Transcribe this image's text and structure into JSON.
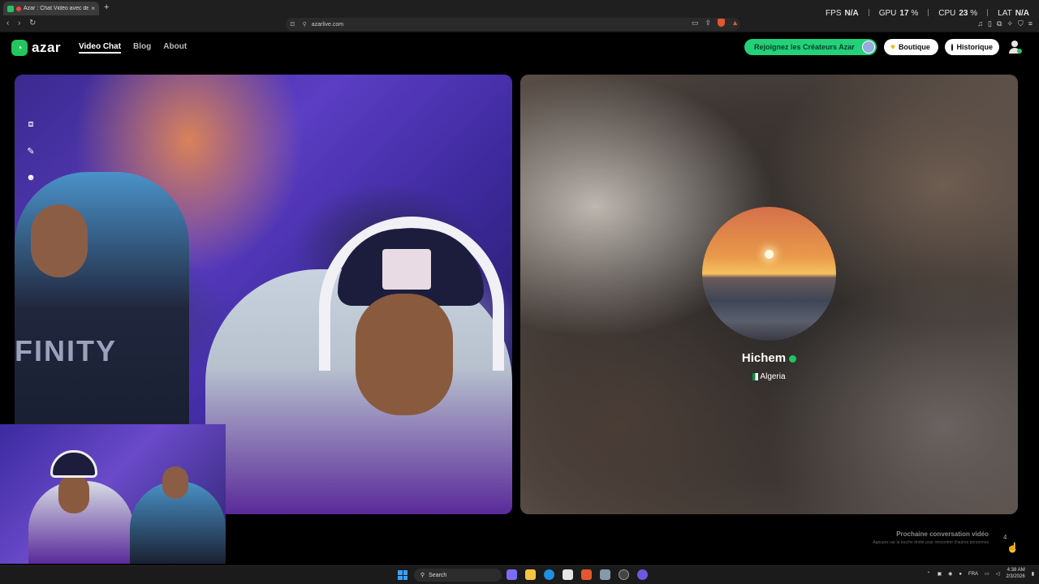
{
  "browser": {
    "tab_title": "Azar : Chat Vidéo avec de no",
    "tab_close": "×",
    "new_tab": "+",
    "url": "azarlive.com",
    "nav": {
      "back": "‹",
      "forward": "›",
      "reload": "↻"
    },
    "bookmark_icon": "bookmark-icon",
    "shield_badge": "1"
  },
  "perf": {
    "fps_label": "FPS",
    "fps_value": "N/A",
    "gpu_label": "GPU",
    "gpu_value": "17",
    "cpu_label": "CPU",
    "cpu_value": "23",
    "lat_label": "LAT",
    "lat_value": "N/A",
    "unit": "%"
  },
  "site": {
    "brand": "azar",
    "nav": [
      {
        "label": "Video Chat",
        "active": true
      },
      {
        "label": "Blog",
        "active": false
      },
      {
        "label": "About",
        "active": false
      }
    ],
    "creators_label": "Rejoignez les Créateurs Azar",
    "boutique_label": "Boutique",
    "historique_label": "Historique",
    "accent": "#22c55e"
  },
  "remote": {
    "name": "Hichem",
    "country": "Algeria"
  },
  "next": {
    "title": "Prochaine conversation vidéo",
    "subtitle": "Appuyez sur la touche droite pour rencontrer d'autres personnes",
    "count": "4"
  },
  "local_overlay_text": "FINITY",
  "taskbar": {
    "search_placeholder": "Search",
    "lang": "FRA",
    "time": "4:38 AM",
    "date": "2/3/2026"
  }
}
